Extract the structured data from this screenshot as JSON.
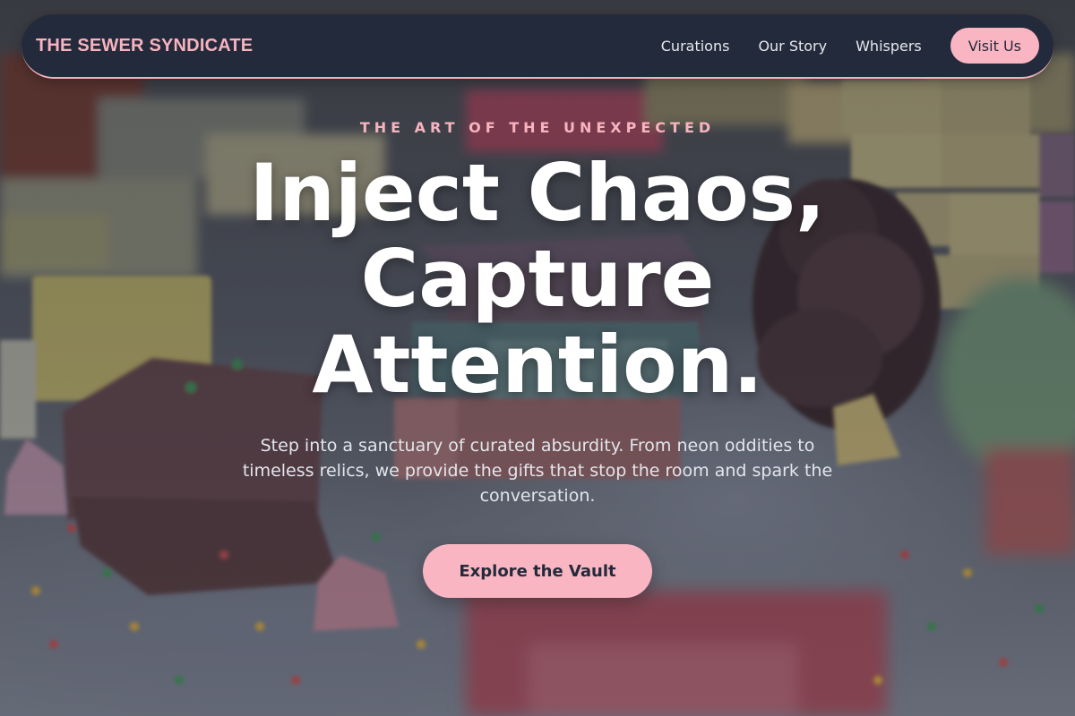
{
  "brand": {
    "name": "THE SEWER SYNDICATE"
  },
  "nav": {
    "links": [
      {
        "label": "Curations"
      },
      {
        "label": "Our Story"
      },
      {
        "label": "Whispers"
      }
    ],
    "visit_label": "Visit Us"
  },
  "hero": {
    "eyebrow": "THE ART OF THE UNEXPECTED",
    "headline_lines": [
      "Inject Chaos,",
      "Capture",
      "Attention."
    ],
    "subtext": "Step into a sanctuary of curated absurdity. From neon oddities to timeless relics, we provide the gifts that stop the room and spark the conversation.",
    "cta_label": "Explore the Vault"
  },
  "colors": {
    "accent_pink": "#f9b6c2",
    "nav_background": "#232a3b",
    "headline_text": "#ffffff"
  }
}
